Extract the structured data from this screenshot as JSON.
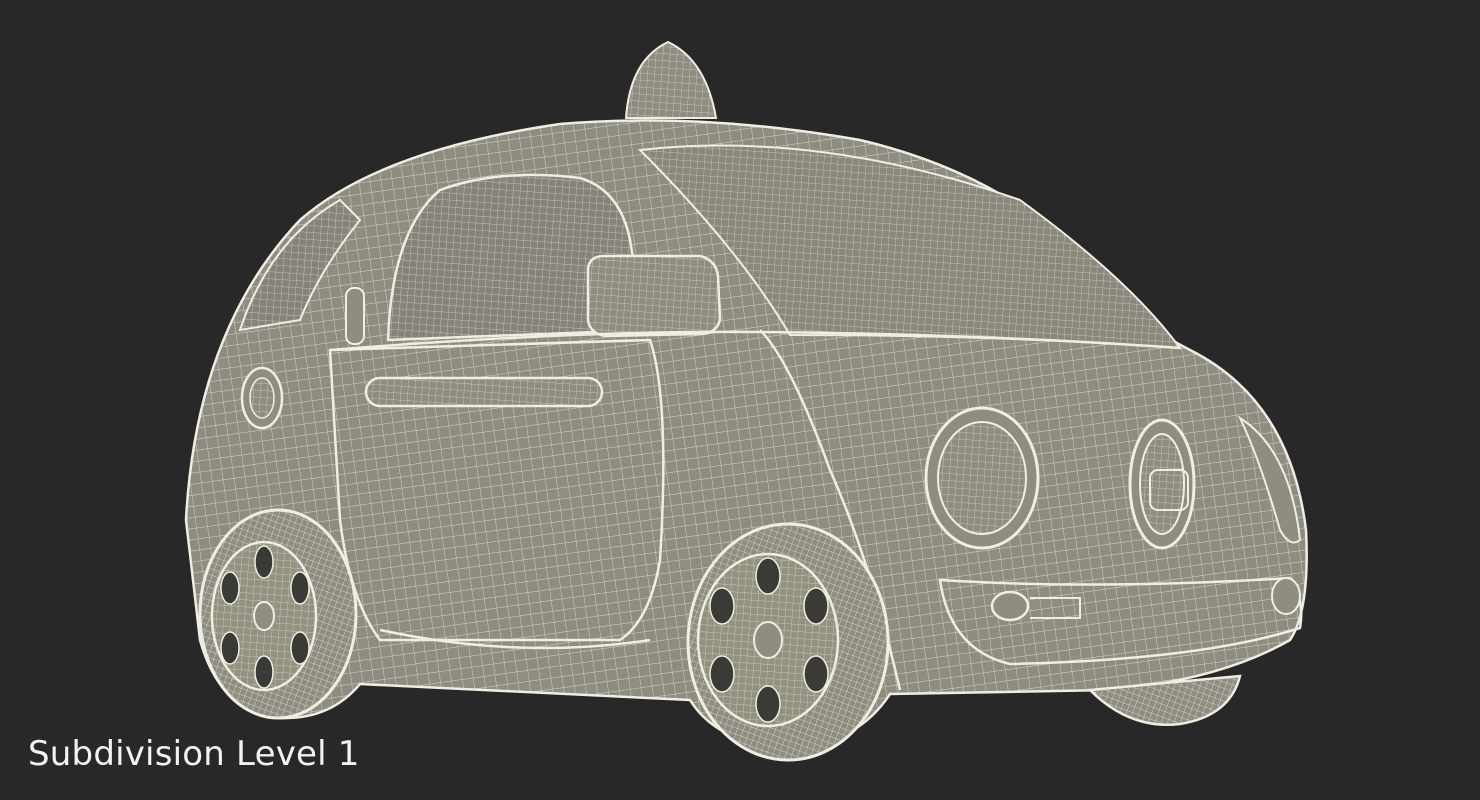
{
  "viewport": {
    "background_color": "#282828",
    "model_surface_color": "#8f8d82",
    "wire_color": "#efeee2",
    "caption_text": "Subdivision Level 1",
    "caption_color": "#f2f2f2",
    "model_icon": "car-wireframe"
  }
}
